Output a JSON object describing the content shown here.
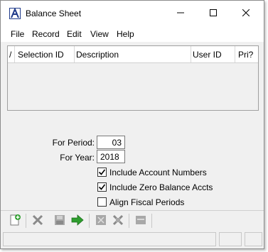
{
  "window": {
    "title": "Balance Sheet",
    "icon": "app-logo-icon"
  },
  "titlebar_buttons": [
    "minimize-icon",
    "maximize-icon",
    "close-icon"
  ],
  "menu": {
    "file": "File",
    "record": "Record",
    "edit": "Edit",
    "view": "View",
    "help": "Help"
  },
  "grid": {
    "columns": {
      "marker": "/",
      "selection_id": "Selection ID",
      "description": "Description",
      "user_id": "User ID",
      "pri": "Pri?"
    },
    "rows": []
  },
  "form": {
    "period_label": "For Period:",
    "period_value": "03",
    "year_label": "For Year:",
    "year_value": "2018",
    "include_account_numbers": {
      "label": "Include Account Numbers",
      "checked": true
    },
    "include_zero_balance": {
      "label": "Include Zero Balance Accts",
      "checked": true
    },
    "align_fiscal_periods": {
      "label": "Align Fiscal Periods",
      "checked": false
    }
  },
  "toolbar": [
    "new-record-icon",
    "delete-icon",
    "save-icon",
    "process-icon",
    "print-preview-icon",
    "clear-icon",
    "settings-icon"
  ],
  "colors": {
    "window_bg": "#f0f0f0",
    "process_arrow": "#2e9e2e",
    "new_icon_plus": "#2e9e2e",
    "logo": "#1f3a8a"
  }
}
